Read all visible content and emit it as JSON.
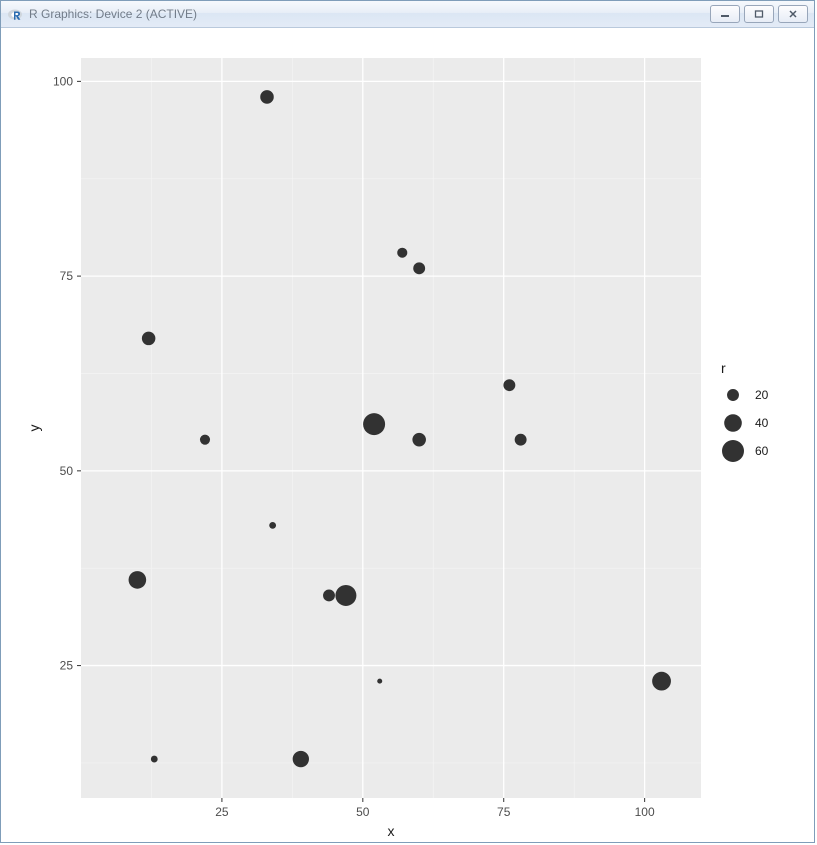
{
  "window": {
    "title": "R Graphics: Device 2 (ACTIVE)"
  },
  "chart_data": {
    "type": "scatter",
    "xlabel": "x",
    "ylabel": "y",
    "xlim": [
      0,
      110
    ],
    "ylim": [
      8,
      103
    ],
    "x_ticks": [
      25,
      50,
      75,
      100
    ],
    "y_ticks": [
      25,
      50,
      75,
      100
    ],
    "x_minor_ticks": [
      12.5,
      37.5,
      62.5,
      87.5
    ],
    "y_minor_ticks": [
      12.5,
      37.5,
      62.5,
      87.5
    ],
    "size_var": "r",
    "series": [
      {
        "x": 33,
        "y": 98,
        "r": 25
      },
      {
        "x": 57,
        "y": 78,
        "r": 15
      },
      {
        "x": 60,
        "y": 76,
        "r": 20
      },
      {
        "x": 12,
        "y": 67,
        "r": 25
      },
      {
        "x": 76,
        "y": 61,
        "r": 20
      },
      {
        "x": 52,
        "y": 56,
        "r": 60
      },
      {
        "x": 22,
        "y": 54,
        "r": 15
      },
      {
        "x": 60,
        "y": 54,
        "r": 25
      },
      {
        "x": 78,
        "y": 54,
        "r": 20
      },
      {
        "x": 34,
        "y": 43,
        "r": 8
      },
      {
        "x": 10,
        "y": 36,
        "r": 40
      },
      {
        "x": 44,
        "y": 34,
        "r": 20
      },
      {
        "x": 47,
        "y": 34,
        "r": 55
      },
      {
        "x": 53,
        "y": 23,
        "r": 5
      },
      {
        "x": 103,
        "y": 23,
        "r": 45
      },
      {
        "x": 13,
        "y": 13,
        "r": 8
      },
      {
        "x": 39,
        "y": 13,
        "r": 35
      }
    ],
    "legend": {
      "title": "r",
      "items": [
        {
          "label": "20",
          "r": 20
        },
        {
          "label": "40",
          "r": 40
        },
        {
          "label": "60",
          "r": 60
        }
      ]
    }
  }
}
